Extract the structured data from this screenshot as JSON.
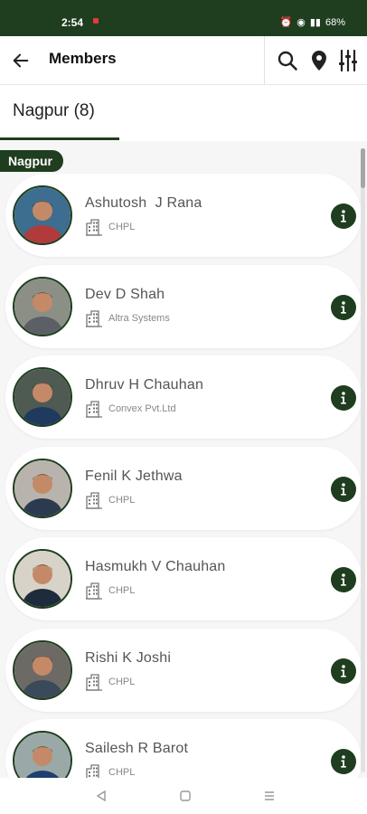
{
  "status_bar": {
    "time": "2:54",
    "battery": "68%"
  },
  "header": {
    "title": "Members"
  },
  "tab": {
    "label": "Nagpur (8)"
  },
  "group": {
    "label": "Nagpur"
  },
  "members": [
    {
      "name": "Ashutosh  J Rana",
      "company": "CHPL",
      "avatar_bg": "#3d6e8f",
      "shirt": "#b23a3a"
    },
    {
      "name": "Dev D Shah",
      "company": "Altra Systems",
      "avatar_bg": "#8c8f86",
      "shirt": "#5c5f66"
    },
    {
      "name": "Dhruv H Chauhan",
      "company": "Convex Pvt.Ltd",
      "avatar_bg": "#4e5a52",
      "shirt": "#1f3a5f"
    },
    {
      "name": "Fenil K Jethwa",
      "company": "CHPL",
      "avatar_bg": "#b8b4ad",
      "shirt": "#2b3a4e"
    },
    {
      "name": "Hasmukh V Chauhan",
      "company": "CHPL",
      "avatar_bg": "#d8d3c8",
      "shirt": "#1e2b3c"
    },
    {
      "name": "Rishi K Joshi",
      "company": "CHPL",
      "avatar_bg": "#6d6a66",
      "shirt": "#3a4a5a"
    },
    {
      "name": "Sailesh R Barot",
      "company": "CHPL",
      "avatar_bg": "#9aa9a8",
      "shirt": "#1f3f6e"
    }
  ],
  "colors": {
    "primary": "#1f3d1f",
    "card_bg": "#ffffff",
    "list_bg": "#f6f6f6"
  }
}
